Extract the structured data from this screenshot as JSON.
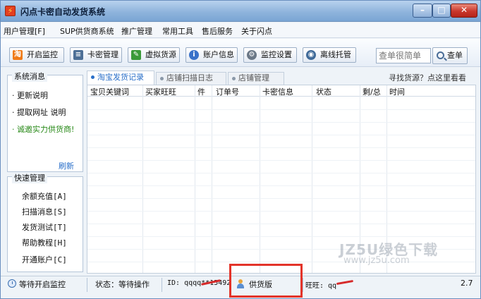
{
  "window": {
    "title": "闪点卡密自动发货系统",
    "controls": {
      "minimize": "–",
      "maximize": "□",
      "close": "✕"
    }
  },
  "menu": [
    {
      "label": "用户管理[F]"
    },
    {
      "label": "SUP供货商系统"
    },
    {
      "label": "推广管理"
    },
    {
      "label": "常用工具"
    },
    {
      "label": "售后服务"
    },
    {
      "label": "关于闪点"
    }
  ],
  "toolbar": {
    "buttons": [
      {
        "label": "开启监控",
        "icon": "taobao-icon",
        "color": "#f07b18"
      },
      {
        "label": "卡密管理",
        "icon": "list-icon",
        "color": "#4d6f96"
      },
      {
        "label": "虚拟货源",
        "icon": "pen-icon",
        "color": "#3a9a3a"
      },
      {
        "label": "账户信息",
        "icon": "info-icon",
        "color": "#3a72c9"
      },
      {
        "label": "监控设置",
        "icon": "gear-icon",
        "color": "#6b7887"
      },
      {
        "label": "离线托管",
        "icon": "host-icon",
        "color": "#3f6a99"
      }
    ],
    "search": {
      "placeholder": "查单很简单",
      "button_label": "查单"
    }
  },
  "left_panel": {
    "messages": {
      "title": "系统消息",
      "items": [
        {
          "text": "· 更新说明"
        },
        {
          "text": "· 提取网址 说明"
        },
        {
          "text": "· 诚邀实力供货商!"
        }
      ],
      "refresh": "刷新"
    },
    "quick": {
      "title": "快速管理",
      "items": [
        {
          "label": "余额充值[A]"
        },
        {
          "label": "扫描消息[S]"
        },
        {
          "label": "发货测试[T]"
        },
        {
          "label": "帮助教程[H]"
        },
        {
          "label": "开通账户[C]"
        }
      ]
    }
  },
  "tabs": [
    {
      "label": "淘宝发货记录",
      "active": true
    },
    {
      "label": "店铺扫描日志",
      "active": false
    },
    {
      "label": "店铺管理",
      "active": false
    }
  ],
  "hint": "寻找货源？点这里看看",
  "table": {
    "columns": [
      "宝贝关键词",
      "买家旺旺",
      "件",
      "订单号",
      "卡密信息",
      "状态",
      "剩/总",
      "时间"
    ]
  },
  "watermark": {
    "top": "JZ5U绿色下载",
    "bottom": "www.jz5u.com"
  },
  "status": {
    "monitor": "等待开启监控",
    "state": "状态：等待操作",
    "id": "ID: qqqq**15492",
    "edition": "供货版",
    "wangwang": "旺旺: qq",
    "tail": "2.7"
  }
}
